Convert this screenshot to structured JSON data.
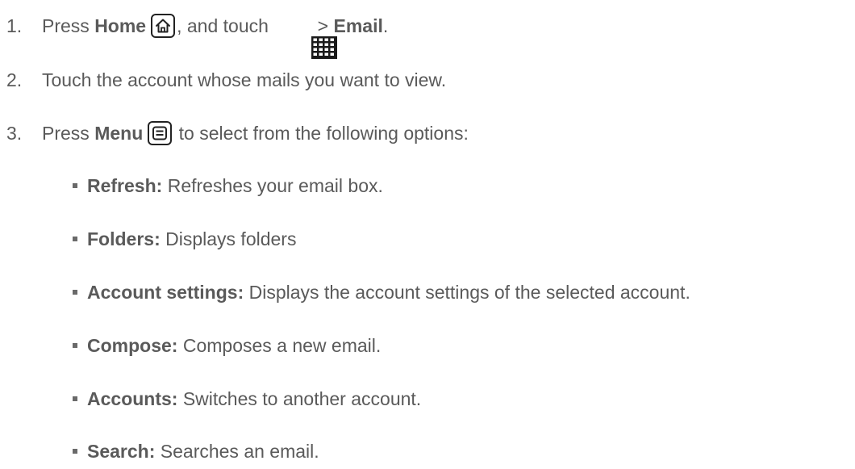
{
  "steps": [
    {
      "number": "1.",
      "parts": {
        "t1": "Press ",
        "b1": "Home",
        "t2": ", and touch ",
        "t3": " > ",
        "b2": "Email",
        "t4": "."
      },
      "icons": [
        "home-icon",
        "apps-grid-icon"
      ]
    },
    {
      "number": "2.",
      "text": "Touch the account whose mails you want to view."
    },
    {
      "number": "3.",
      "parts": {
        "t1": "Press ",
        "b1": "Menu",
        "t2": " to select from the following options:"
      },
      "icons": [
        "menu-icon"
      ]
    }
  ],
  "options": [
    {
      "label": "Refresh:",
      "desc": " Refreshes your email box."
    },
    {
      "label": "Folders:",
      "desc": " Displays folders"
    },
    {
      "label": "Account settings:",
      "desc": " Displays the account settings of the selected account."
    },
    {
      "label": "Compose:",
      "desc": " Composes a new email."
    },
    {
      "label": "Accounts:",
      "desc": " Switches to another account."
    },
    {
      "label": "Search:",
      "desc": " Searches an email."
    }
  ],
  "colors": {
    "text": "#5a5a5a",
    "icon_border": "#222222",
    "grid_icon": "#1a1a1a"
  }
}
